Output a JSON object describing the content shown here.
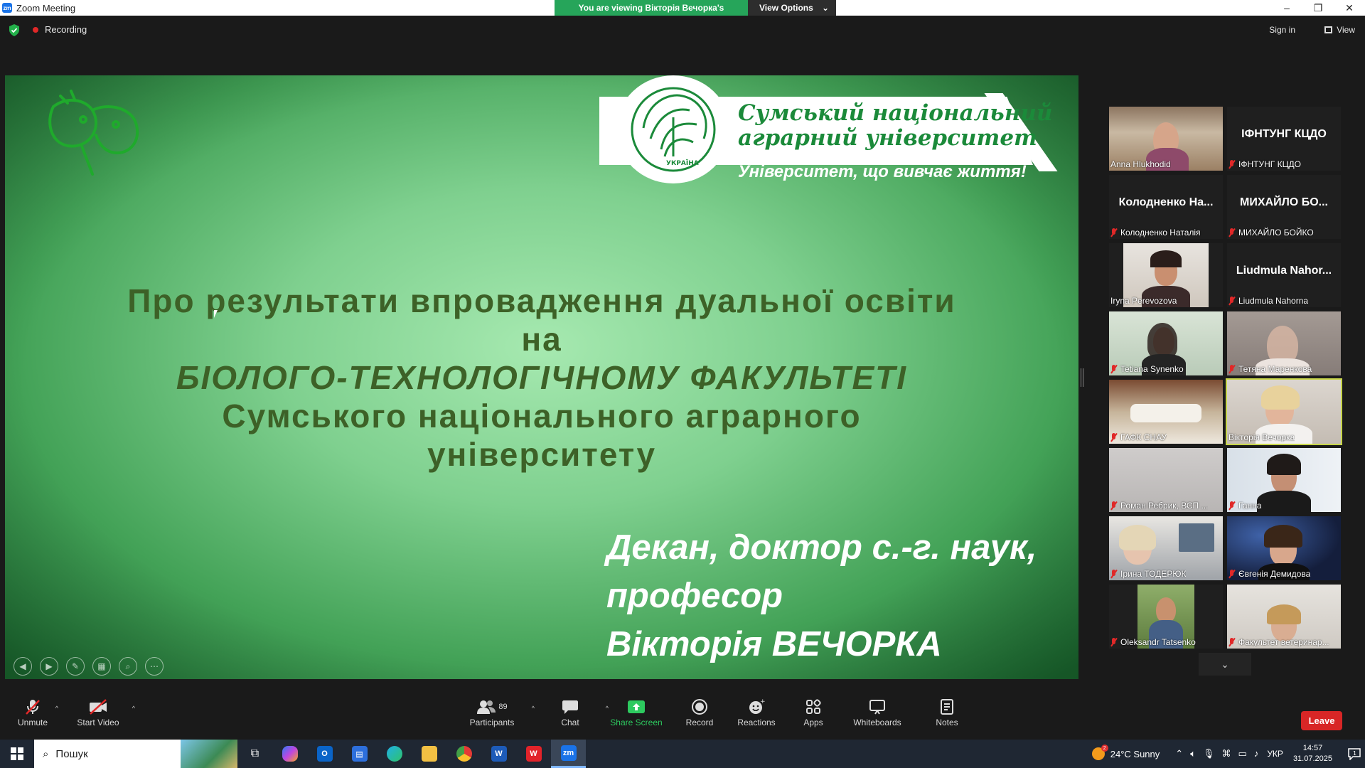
{
  "window": {
    "title": "Zoom Meeting",
    "viewing_message": "You are viewing Вікторія Вечорка's screen",
    "view_options": "View Options"
  },
  "topbar": {
    "recording": "Recording",
    "sign_in": "Sign in",
    "view": "View"
  },
  "slide": {
    "university_name_line1": "Сумський національний",
    "university_name_line2": "аграрний університет",
    "slogan": "Університет, що вивчає життя!",
    "seal_text": "УКРАЇНА",
    "title_line1": "Про результати впровадження дуальної освіти",
    "title_line2": "на",
    "title_line3": "БІОЛОГО-ТЕХНОЛОГІЧНОМУ ФАКУЛЬТЕТІ",
    "title_line4": "Сумського національного аграрного",
    "title_line5": "університету",
    "author_line1": "Декан, доктор с.-г. наук,",
    "author_line2": "професор",
    "author_line3": "Вікторія ВЕЧОРКА"
  },
  "participants": [
    {
      "label": "Anna Hlukhodid",
      "big_name": "",
      "muted": false,
      "video": "room-a"
    },
    {
      "label": "ІФНТУНГ КЦДО",
      "big_name": "ІФНТУНГ КЦДО",
      "muted": true,
      "video": ""
    },
    {
      "label": "Колодненко Наталія",
      "big_name": "Колодненко  На...",
      "muted": true,
      "video": ""
    },
    {
      "label": "МИХАЙЛО БОЙКО",
      "big_name": "МИХАЙЛО БО...",
      "muted": true,
      "video": ""
    },
    {
      "label": "Iryna Perevozova",
      "big_name": "",
      "muted": false,
      "video": "face-dark"
    },
    {
      "label": "Liudmula Nahorna",
      "big_name": "Liudmula  Nahor...",
      "muted": true,
      "video": ""
    },
    {
      "label": "Tetiana Synenko",
      "big_name": "",
      "muted": true,
      "video": "face-light"
    },
    {
      "label": "Тетяна Маренкова",
      "big_name": "",
      "muted": true,
      "video": "face-blur"
    },
    {
      "label": "ГАФК СНАУ",
      "big_name": "",
      "muted": true,
      "video": "room-b"
    },
    {
      "label": "Вікторія Вечорка",
      "big_name": "",
      "muted": false,
      "video": "face-light",
      "active": true
    },
    {
      "label": "Роман Ребрик, ВСП ...",
      "big_name": "",
      "muted": true,
      "video": "wall"
    },
    {
      "label": "Ганна",
      "big_name": "",
      "muted": true,
      "video": "face-dark"
    },
    {
      "label": "Ірина ТОДЕРЮК",
      "big_name": "",
      "muted": true,
      "video": "office"
    },
    {
      "label": "Євгенія Демидова",
      "big_name": "",
      "muted": true,
      "video": "space"
    },
    {
      "label": "Oleksandr Tatsenko",
      "big_name": "",
      "muted": true,
      "video": "outdoor"
    },
    {
      "label": "Факультет ветеринар...",
      "big_name": "",
      "muted": true,
      "video": "face-light"
    }
  ],
  "toolbar": {
    "unmute": "Unmute",
    "start_video": "Start Video",
    "participants": "Participants",
    "participants_count": "89",
    "chat": "Chat",
    "share_screen": "Share Screen",
    "record": "Record",
    "reactions": "Reactions",
    "apps": "Apps",
    "whiteboards": "Whiteboards",
    "notes": "Notes",
    "leave": "Leave"
  },
  "taskbar": {
    "search_placeholder": "Пошук",
    "weather": "24°C  Sunny",
    "weather_badge": "2",
    "language": "УКР",
    "time": "14:57",
    "date": "31.07.2025",
    "notif_count": "1"
  },
  "colors": {
    "zoom_green": "#26a55a",
    "leave_red": "#d82626",
    "active_speaker": "#c8d64a",
    "slide_title": "#3d6127"
  }
}
